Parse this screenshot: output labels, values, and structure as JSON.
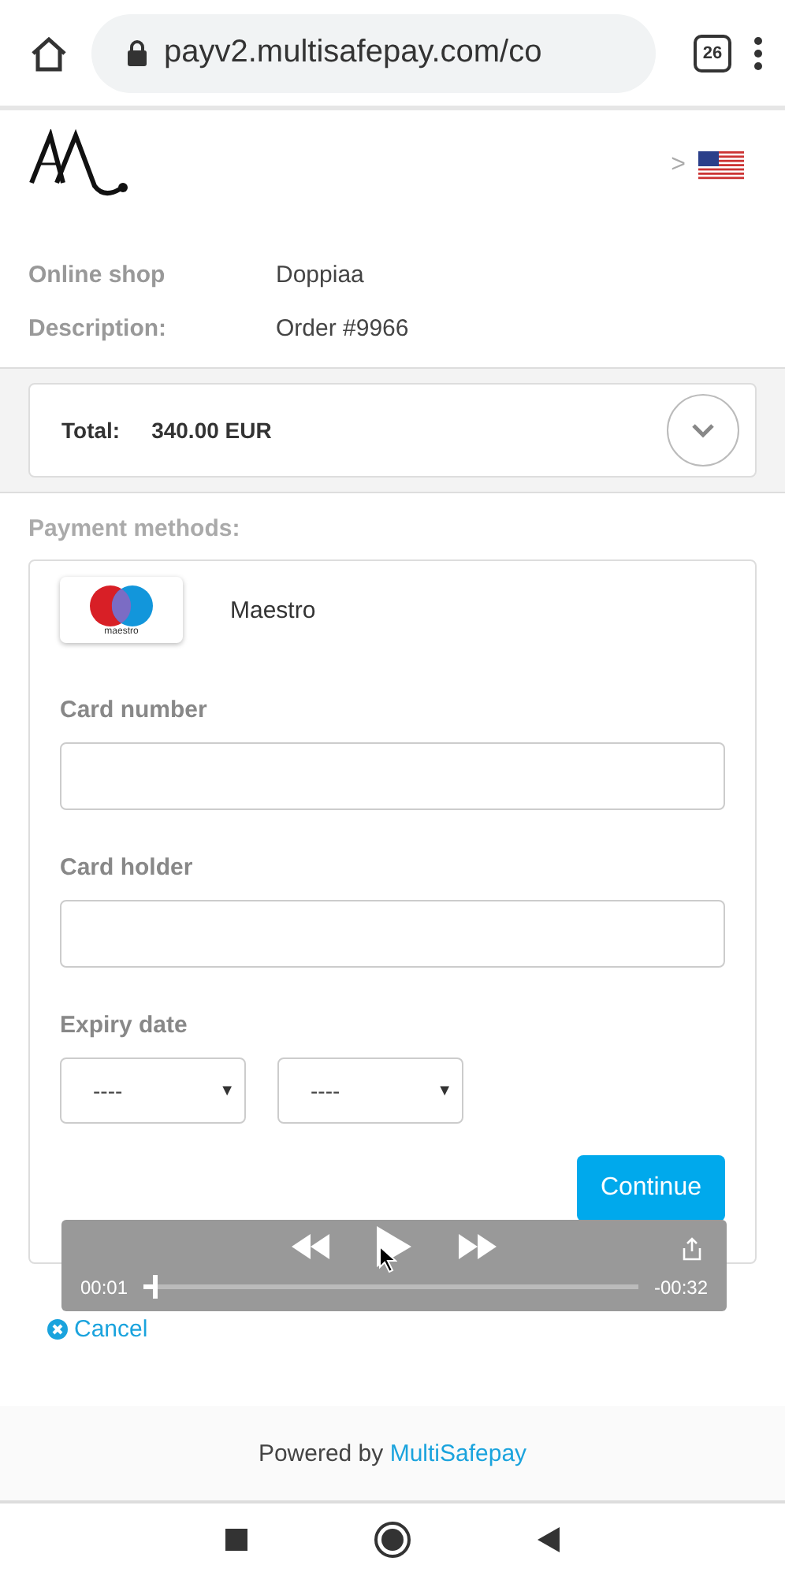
{
  "browser": {
    "url": "payv2.multisafepay.com/co",
    "tab_count": "26"
  },
  "header": {
    "language_arrow": ">"
  },
  "details": [
    {
      "label": "Online shop",
      "value": "Doppiaa"
    },
    {
      "label": "Description:",
      "value": "Order #9966"
    }
  ],
  "total": {
    "label": "Total:",
    "amount": "340.00 EUR",
    "expanded": false
  },
  "payment": {
    "heading": "Payment methods:",
    "method": "Maestro",
    "logo_text": "maestro",
    "fields": [
      {
        "label": "Card number",
        "kind": "text"
      },
      {
        "label": "Card holder",
        "kind": "text"
      },
      {
        "label": "Expiry date",
        "kind": "selects",
        "options": [
          "----",
          "----"
        ],
        "caret": "▼"
      }
    ],
    "continue": "Continue",
    "cancel": "Cancel"
  },
  "video_player": {
    "elapsed": "00:01",
    "remaining": "-00:32",
    "level": 0.03
  },
  "footer": {
    "prefix": "Powered by",
    "brand": "MultiSafepay"
  }
}
